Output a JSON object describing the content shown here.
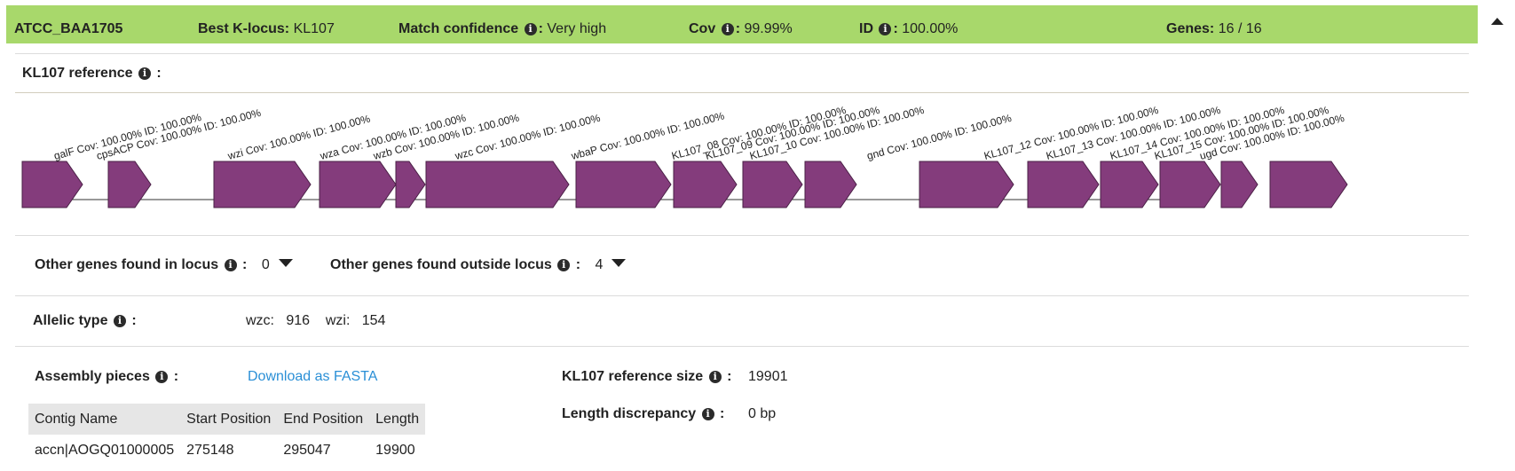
{
  "header": {
    "assembly_name": "ATCC_BAA1705",
    "best_k_locus_label": "Best K-locus:",
    "best_k_locus_value": "KL107",
    "match_conf_label": "Match confidence",
    "match_conf_value": "Very high",
    "cov_label": "Cov",
    "cov_value": "99.99%",
    "id_label": "ID",
    "id_value": "100.00%",
    "genes_label": "Genes:",
    "genes_value": "16 / 16"
  },
  "reference": {
    "title": "KL107 reference"
  },
  "genes": [
    {
      "name": "galF",
      "cov": "100.00%",
      "id": "100.00%"
    },
    {
      "name": "cpsACP",
      "cov": "100.00%",
      "id": "100.00%"
    },
    {
      "name": "wzi",
      "cov": "100.00%",
      "id": "100.00%"
    },
    {
      "name": "wza",
      "cov": "100.00%",
      "id": "100.00%"
    },
    {
      "name": "wzb",
      "cov": "100.00%",
      "id": "100.00%"
    },
    {
      "name": "wzc",
      "cov": "100.00%",
      "id": "100.00%"
    },
    {
      "name": "wbaP",
      "cov": "100.00%",
      "id": "100.00%"
    },
    {
      "name": "KL107_08",
      "cov": "100.00%",
      "id": "100.00%"
    },
    {
      "name": "KL107_09",
      "cov": "100.00%",
      "id": "100.00%"
    },
    {
      "name": "KL107_10",
      "cov": "100.00%",
      "id": "100.00%"
    },
    {
      "name": "gnd",
      "cov": "100.00%",
      "id": "100.00%"
    },
    {
      "name": "KL107_12",
      "cov": "100.00%",
      "id": "100.00%"
    },
    {
      "name": "KL107_13",
      "cov": "100.00%",
      "id": "100.00%"
    },
    {
      "name": "KL107_14",
      "cov": "100.00%",
      "id": "100.00%"
    },
    {
      "name": "KL107_15",
      "cov": "100.00%",
      "id": "100.00%"
    },
    {
      "name": "ugd",
      "cov": "100.00%",
      "id": "100.00%"
    }
  ],
  "gene_label_cov": "Cov:",
  "gene_label_id": "ID:",
  "gene_color": "#843c7c",
  "other_genes": {
    "in_locus_label": "Other genes found in locus",
    "in_locus_value": "0",
    "outside_locus_label": "Other genes found outside locus",
    "outside_locus_value": "4"
  },
  "allelic": {
    "label": "Allelic type",
    "wzc_label": "wzc:",
    "wzc_value": "916",
    "wzi_label": "wzi:",
    "wzi_value": "154"
  },
  "assembly": {
    "label": "Assembly pieces",
    "download_link": "Download as FASTA",
    "columns": [
      "Contig Name",
      "Start Position",
      "End Position",
      "Length"
    ],
    "rows": [
      [
        "accn|AOGQ01000005",
        "275148",
        "295047",
        "19900"
      ]
    ]
  },
  "ref_size": {
    "label": "KL107 reference size",
    "value": "19901"
  },
  "length_disc": {
    "label": "Length discrepancy",
    "value": "0 bp"
  },
  "colors": {
    "header_bg": "#a8d86b",
    "link": "#2a8fd6",
    "table_header_bg": "#e6e6e6"
  }
}
